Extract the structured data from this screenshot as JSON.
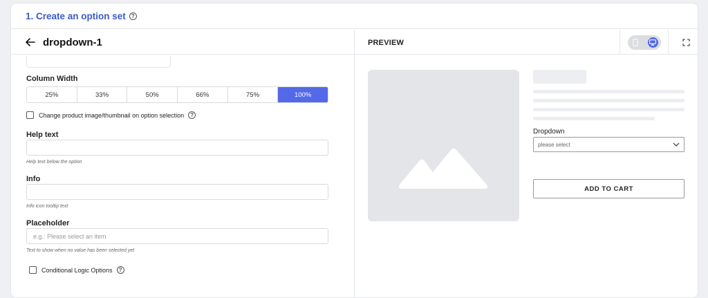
{
  "card": {
    "title": "1. Create an option set",
    "help_icon": "question-circle-icon"
  },
  "editor": {
    "title": "dropdown-1",
    "back_icon": "arrow-left-icon",
    "column_width": {
      "label": "Column Width",
      "options": [
        "25%",
        "33%",
        "50%",
        "66%",
        "75%",
        "100%"
      ],
      "selected": "100%"
    },
    "change_image": {
      "label": "Change product image/thumbnail on option selection",
      "checked": false
    },
    "help_text": {
      "label": "Help text",
      "value": "",
      "hint": "Help text below the option"
    },
    "info": {
      "label": "Info",
      "value": "",
      "hint": "Info icon tooltip text"
    },
    "placeholder": {
      "label": "Placeholder",
      "placeholder": "e.g.: Please select an item",
      "hint": "Text to show when no value has been selected yet"
    },
    "conditional": {
      "label": "Conditional Logic Options",
      "checked": false
    }
  },
  "preview": {
    "title": "PREVIEW",
    "device_toggle": {
      "options": [
        "mobile-icon",
        "desktop-icon"
      ],
      "selected": "desktop-icon"
    },
    "expand_icon": "expand-icon",
    "image_icon": "image-placeholder-icon",
    "dropdown": {
      "label": "Dropdown",
      "placeholder": "please select"
    },
    "add_to_cart": "ADD TO CART"
  },
  "colors": {
    "accent": "#5369e8",
    "title": "#3b5bc9",
    "placeholder_bg": "#e4e5e8"
  }
}
